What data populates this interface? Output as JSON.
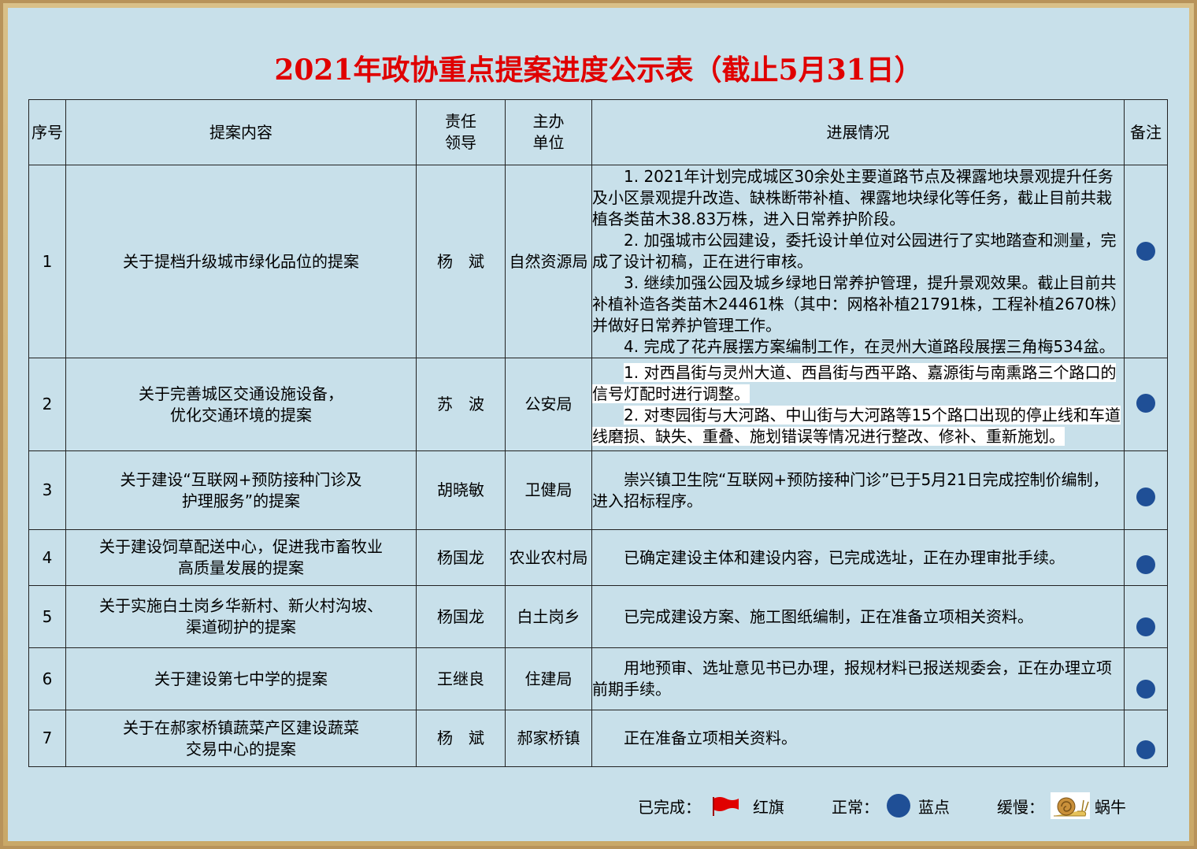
{
  "title": "2021年政协重点提案进度公示表（截止5月31日）",
  "table": {
    "headers": {
      "no": "序号",
      "content": "提案内容",
      "leader_1": "责任",
      "leader_2": "领导",
      "unit_1": "主办",
      "unit_2": "单位",
      "progress": "进展情况",
      "note": "备注"
    },
    "rows": [
      {
        "no": "1",
        "content_1": "关于提档升级城市绿化品位的提案",
        "content_2": "",
        "leader": "杨　斌",
        "unit": "自然资源局",
        "progress": [
          "1. 2021年计划完成城区30余处主要道路节点及裸露地块景观提升任务及小区景观提升改造、缺株断带补植、裸露地块绿化等任务，截止目前共栽植各类苗木38.83万株，进入日常养护阶段。",
          "2. 加强城市公园建设，委托设计单位对公园进行了实地踏查和测量，完成了设计初稿，正在进行审核。",
          "3. 继续加强公园及城乡绿地日常养护管理，提升景观效果。截止目前共补植补造各类苗木24461株（其中：网格补植21791株，工程补植2670株）并做好日常养护管理工作。",
          "4. 完成了花卉展摆方案编制工作，在灵州大道路段展摆三角梅534盆。"
        ],
        "status": "normal"
      },
      {
        "no": "2",
        "content_1": "关于完善城区交通设施设备，",
        "content_2": "优化交通环境的提案",
        "leader": "苏　波",
        "unit": "公安局",
        "progress": [
          "1. 对西昌街与灵州大道、西昌街与西平路、嘉源街与南熏路三个路口的信号灯配时进行调整。",
          "2. 对枣园街与大河路、中山街与大河路等15个路口出现的停止线和车道线磨损、缺失、重叠、施划错误等情况进行整改、修补、重新施划。"
        ],
        "status": "normal"
      },
      {
        "no": "3",
        "content_1": "关于建设“互联网+预防接种门诊及",
        "content_2": "护理服务”的提案",
        "leader": "胡晓敏",
        "unit": "卫健局",
        "progress": [
          "崇兴镇卫生院“互联网+预防接种门诊”已于5月21日完成控制价编制，进入招标程序。"
        ],
        "status": "normal"
      },
      {
        "no": "4",
        "content_1": "关于建设饲草配送中心，促进我市畜牧业",
        "content_2": "高质量发展的提案",
        "leader": "杨国龙",
        "unit": "农业农村局",
        "progress": [
          "已确定建设主体和建设内容，已完成选址，正在办理审批手续。"
        ],
        "status": "normal"
      },
      {
        "no": "5",
        "content_1": "关于实施白土岗乡华新村、新火村沟坡、",
        "content_2": "渠道砌护的提案",
        "leader": "杨国龙",
        "unit": "白土岗乡",
        "progress": [
          "已完成建设方案、施工图纸编制，正在准备立项相关资料。"
        ],
        "status": "normal"
      },
      {
        "no": "6",
        "content_1": "关于建设第七中学的提案",
        "content_2": "",
        "leader": "王继良",
        "unit": "住建局",
        "progress": [
          "用地预审、选址意见书已办理，报规材料已报送规委会，正在办理立项前期手续。"
        ],
        "status": "normal"
      },
      {
        "no": "7",
        "content_1": "关于在郝家桥镇蔬菜产区建设蔬菜",
        "content_2": "交易中心的提案",
        "leader": "杨　斌",
        "unit": "郝家桥镇",
        "progress": [
          "正在准备立项相关资料。"
        ],
        "status": "normal"
      }
    ]
  },
  "legend": {
    "completed_label": "已完成：",
    "completed_symbol": "红旗",
    "normal_label": "正常：",
    "normal_symbol": "蓝点",
    "slow_label": "缓慢：",
    "slow_symbol": "蜗牛",
    "completed_icon": "red-flag-icon",
    "normal_icon": "blue-dot-icon",
    "slow_icon": "snail-icon"
  },
  "colors": {
    "title": "#e00000",
    "background": "#c8e0ea",
    "dot": "#1f4f96",
    "frame": "#b8935a"
  }
}
